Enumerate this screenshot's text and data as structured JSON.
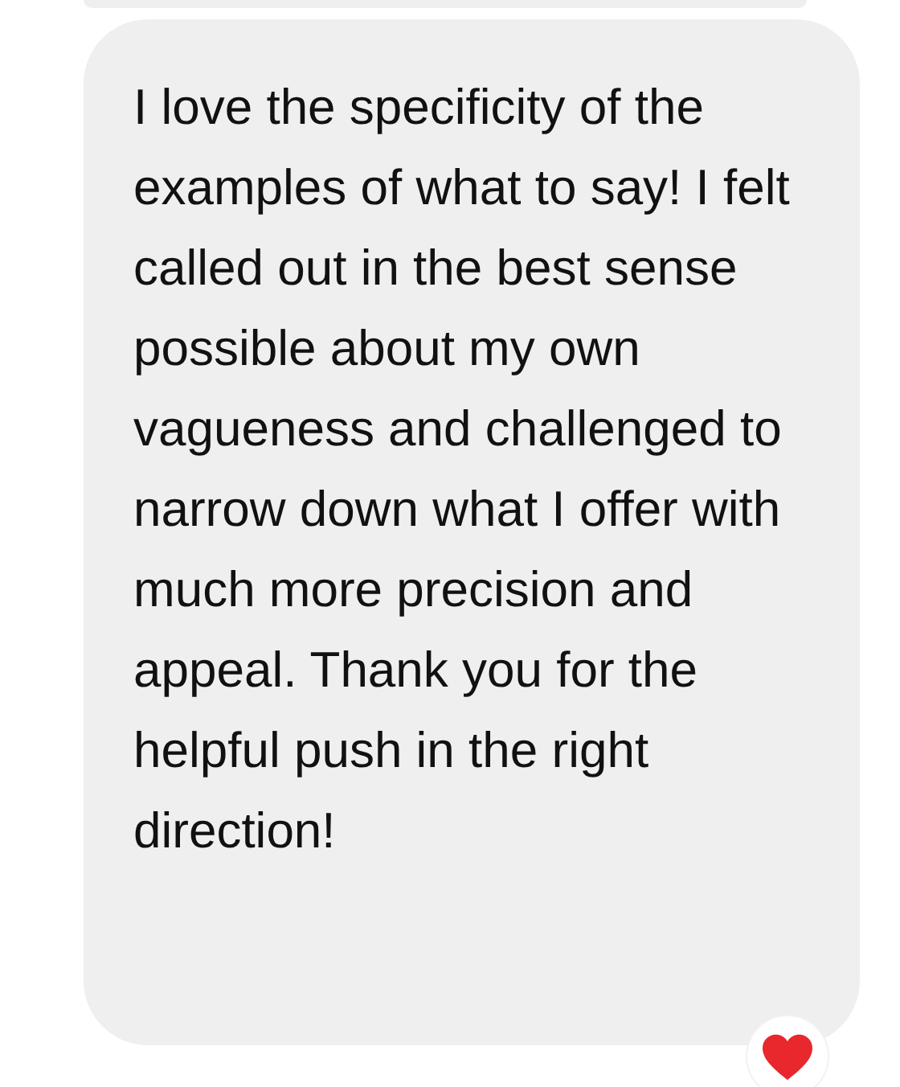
{
  "message": {
    "text": "I love the specificity of the examples of what to say! I felt called out in the best sense possible about my own vagueness and challenged to narrow down what I offer with much more precision and appeal. Thank you for the helpful push in the right direction!",
    "reaction": {
      "kind": "heart"
    }
  }
}
